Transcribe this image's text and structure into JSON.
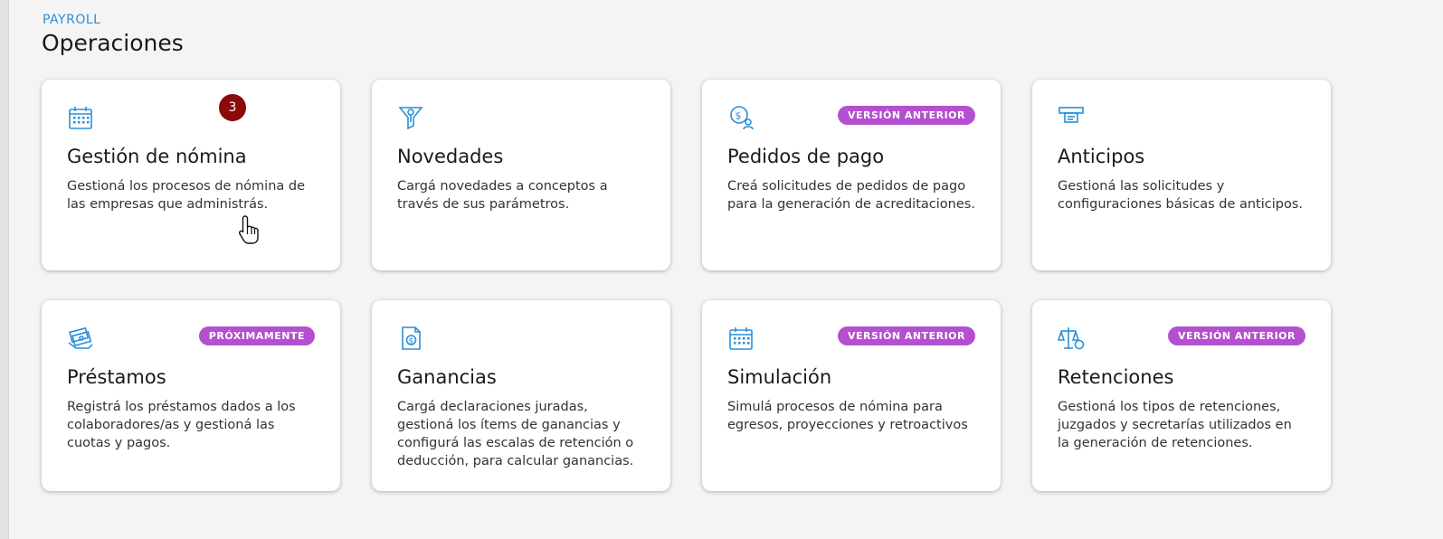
{
  "header": {
    "eyebrow": "PAYROLL",
    "title": "Operaciones"
  },
  "colors": {
    "accent": "#2a8fd8",
    "pill": "#b44fd0",
    "count_badge": "#8c0a0a"
  },
  "cards": [
    {
      "title": "Gestión de nómina",
      "description": "Gestioná los procesos de nómina de las empresas que administrás.",
      "icon": "calendar-icon",
      "count": "3"
    },
    {
      "title": "Novedades",
      "description": "Cargá novedades a conceptos a través de sus parámetros.",
      "icon": "funnel-icon"
    },
    {
      "title": "Pedidos de pago",
      "description": "Creá solicitudes de pedidos de pago para la generación de acreditaciones.",
      "icon": "payment-coin-icon",
      "badge": "VERSIÓN ANTERIOR"
    },
    {
      "title": "Anticipos",
      "description": "Gestioná las solicitudes y configuraciones básicas de anticipos.",
      "icon": "cash-dispenser-icon"
    },
    {
      "title": "Préstamos",
      "description": "Registrá los préstamos dados a los colaboradores/as y gestioná las cuotas y pagos.",
      "icon": "money-hand-icon",
      "badge": "PRÓXIMAMENTE"
    },
    {
      "title": "Ganancias",
      "description": "Cargá declaraciones juradas, gestioná los ítems de ganancias y configurá las escalas de retención o deducción, para calcular ganancias.",
      "icon": "money-document-icon"
    },
    {
      "title": "Simulación",
      "description": "Simulá procesos de nómina para egresos, proyecciones y retroactivos",
      "icon": "calendar-icon",
      "badge": "VERSIÓN ANTERIOR"
    },
    {
      "title": "Retenciones",
      "description": "Gestioná los tipos de retenciones, juzgados y secretarías utilizados en la generación de retenciones.",
      "icon": "balance-scale-icon",
      "badge": "VERSIÓN ANTERIOR"
    }
  ]
}
